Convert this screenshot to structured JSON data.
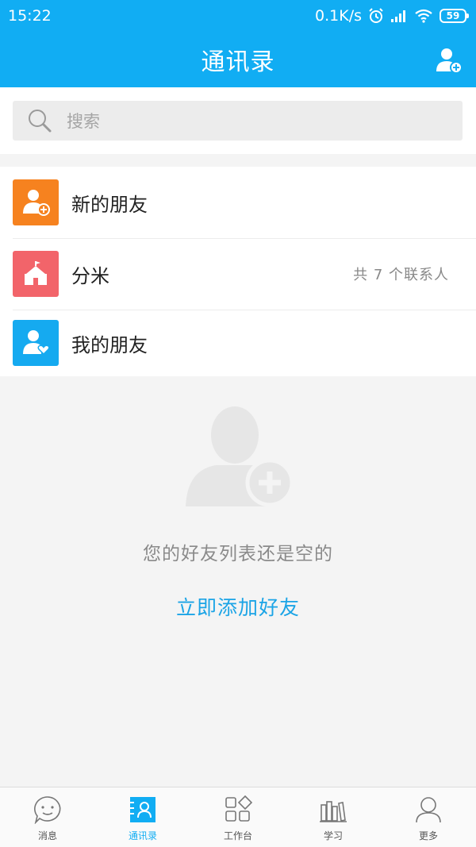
{
  "status_bar": {
    "time": "15:22",
    "speed": "0.1K/s",
    "battery": "59"
  },
  "header": {
    "title": "通讯录"
  },
  "search": {
    "placeholder": "搜索"
  },
  "contacts": {
    "items": [
      {
        "label": "新的朋友",
        "icon": "add-user-icon",
        "color": "#f6821f"
      },
      {
        "label": "分米",
        "icon": "school-icon",
        "color": "#f2646a",
        "meta": "共 7 个联系人"
      },
      {
        "label": "我的朋友",
        "icon": "friend-heart-icon",
        "color": "#15aaf0"
      }
    ]
  },
  "empty_state": {
    "text": "您的好友列表还是空的",
    "action": "立即添加好友"
  },
  "bottom_nav": {
    "items": [
      {
        "label": "消息",
        "icon": "message-icon"
      },
      {
        "label": "通讯录",
        "icon": "contacts-icon",
        "active": true
      },
      {
        "label": "工作台",
        "icon": "workbench-icon"
      },
      {
        "label": "学习",
        "icon": "study-icon"
      },
      {
        "label": "更多",
        "icon": "more-icon"
      }
    ]
  },
  "colors": {
    "primary": "#11adf3",
    "link": "#1ba4e6",
    "background": "#f4f4f4"
  }
}
